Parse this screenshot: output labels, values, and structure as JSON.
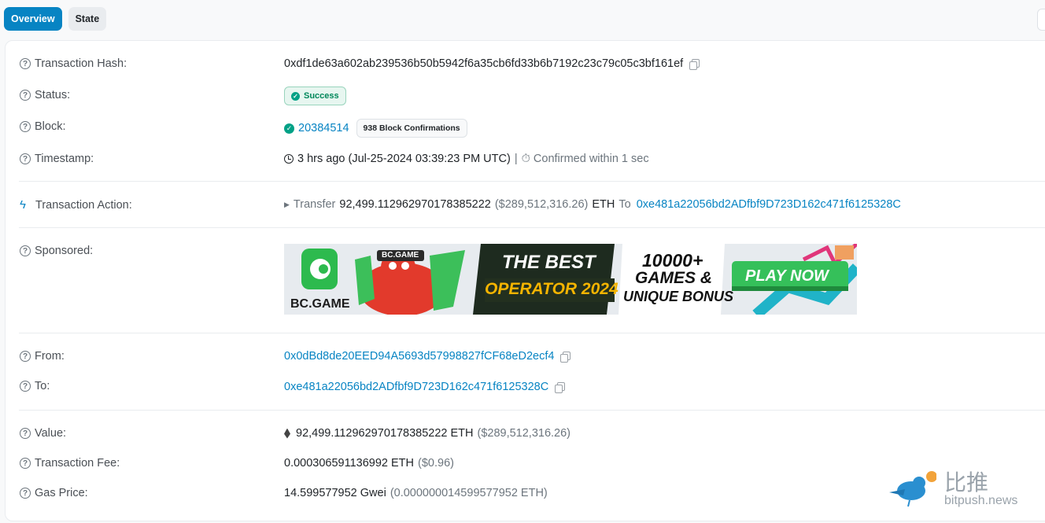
{
  "tabs": [
    {
      "label": "Overview",
      "active": true
    },
    {
      "label": "State",
      "active": false
    }
  ],
  "rows": {
    "hash": {
      "label": "Transaction Hash:",
      "value": "0xdf1de63a602ab239536b50b5942f6a35cb6fd33b6b7192c23c79c05c3bf161ef"
    },
    "status": {
      "label": "Status:",
      "value": "Success"
    },
    "block": {
      "label": "Block:",
      "value": "20384514",
      "confirmations": "938 Block Confirmations"
    },
    "timestamp": {
      "label": "Timestamp:",
      "value": "3 hrs ago (Jul-25-2024 03:39:23 PM UTC)",
      "separator": "|",
      "confirmed": "Confirmed within 1 sec"
    },
    "action": {
      "label": "Transaction Action:",
      "verb": "Transfer",
      "amount": "92,499.112962970178385222",
      "usd": "($289,512,316.26)",
      "token": "ETH",
      "to_word": "To",
      "to_address": "0xe481a22056bd2ADfbf9D723D162c471f6125328C"
    },
    "sponsored": {
      "label": "Sponsored:"
    },
    "from": {
      "label": "From:",
      "value": "0x0dBd8de20EED94A5693d57998827fCF68eD2ecf4"
    },
    "to": {
      "label": "To:",
      "value": "0xe481a22056bd2ADfbf9D723D162c471f6125328C"
    },
    "value": {
      "label": "Value:",
      "value": "92,499.112962970178385222 ETH",
      "usd": "($289,512,316.26)"
    },
    "fee": {
      "label": "Transaction Fee:",
      "value": "0.000306591136992 ETH",
      "usd": "($0.96)"
    },
    "gas": {
      "label": "Gas Price:",
      "value": "14.599577952 Gwei",
      "eth": "(0.000000014599577952 ETH)"
    }
  },
  "ad": {
    "brand": "BC.GAME",
    "mascot_sign": "BC.GAME",
    "headline1": "THE BEST",
    "headline2": "OPERATOR 2024",
    "promo1": "10000+",
    "promo2": "GAMES &",
    "promo3": "UNIQUE BONUS",
    "cta": "PLAY NOW"
  },
  "watermark": {
    "cn": "比推",
    "domain": "bitpush.news"
  },
  "colors": {
    "accent": "#0784c3",
    "success": "#00a186",
    "ad_green": "#35c05a"
  }
}
